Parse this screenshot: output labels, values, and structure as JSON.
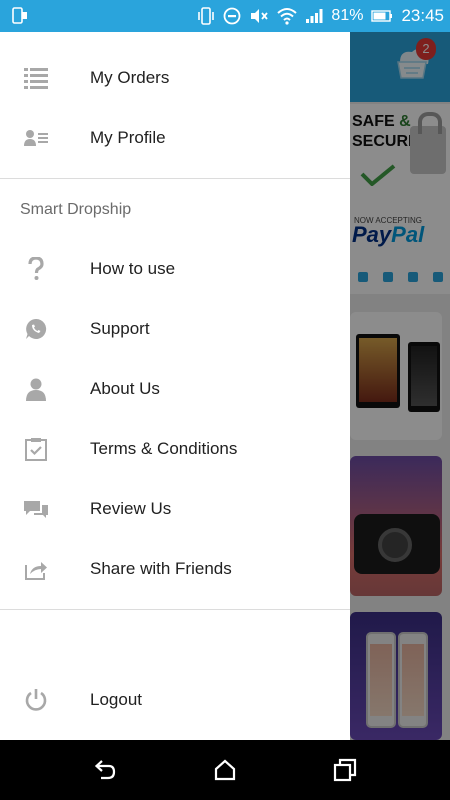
{
  "status_bar": {
    "battery_percent": "81%",
    "time": "23:45",
    "icons": [
      "phone-outline-icon",
      "vibrate-icon",
      "do-not-disturb-icon",
      "mute-icon",
      "wifi-icon",
      "signal-icon",
      "battery-icon"
    ],
    "background_color": "#2aa4dc"
  },
  "background_app": {
    "cart_badge": "2",
    "banner": {
      "title_line1": "SAFE",
      "amp": "&",
      "title_line2": "SECURE",
      "now_accepting": "NOW ACCEPTING",
      "paypal_a": "Pay",
      "paypal_b": "Pal"
    }
  },
  "drawer": {
    "items_top": [
      {
        "label": "My Orders",
        "icon": "list-icon"
      },
      {
        "label": "My Profile",
        "icon": "profile-card-icon"
      }
    ],
    "section_title": "Smart Dropship",
    "items_section": [
      {
        "label": "How to use",
        "icon": "question-mark-icon"
      },
      {
        "label": "Support",
        "icon": "whatsapp-icon"
      },
      {
        "label": "About Us",
        "icon": "person-icon"
      },
      {
        "label": "Terms & Conditions",
        "icon": "clipboard-check-icon"
      },
      {
        "label": "Review Us",
        "icon": "chat-bubbles-icon"
      },
      {
        "label": "Share with Friends",
        "icon": "share-icon"
      }
    ],
    "logout": {
      "label": "Logout",
      "icon": "power-icon"
    }
  },
  "nav_bar": {
    "buttons": [
      "back-icon",
      "home-icon",
      "recents-icon"
    ]
  }
}
